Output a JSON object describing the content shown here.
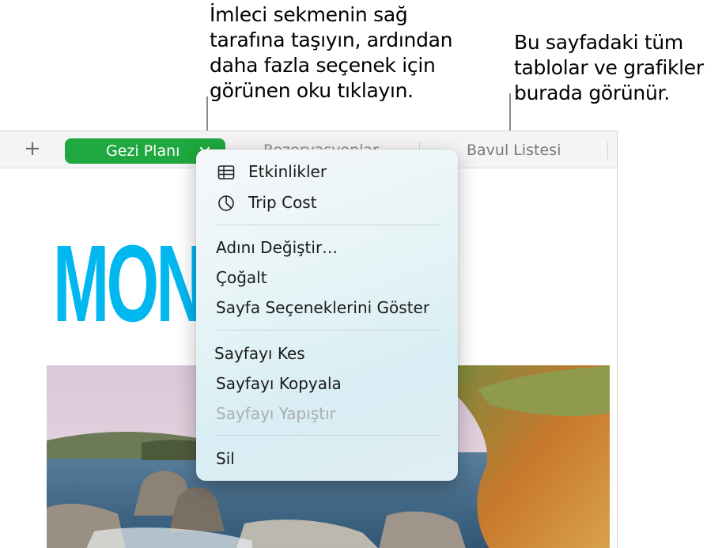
{
  "callouts": {
    "left": "İmleci sekmenin sağ\ntarafına taşıyın, ardından\ndaha fazla seçenek için\ngörünen oku tıklayın.",
    "right": "Bu sayfadaki tüm\ntablolar ve grafikler\nburada görünür."
  },
  "tabbar": {
    "add": "+",
    "tabs": [
      "Gezi Planı",
      "Rezervasyonlar",
      "Bavul Listesi"
    ],
    "active_color": "#1fa83f"
  },
  "page": {
    "title": "MON"
  },
  "menu": {
    "objects": [
      {
        "label": "Etkinlikler",
        "icon": "table-icon"
      },
      {
        "label": "Trip Cost",
        "icon": "pie-chart-icon"
      }
    ],
    "group1": [
      "Adını Değiştir…",
      "Çoğalt",
      "Sayfa Seçeneklerini Göster"
    ],
    "group2": [
      "Sayfayı Kes",
      "Sayfayı Kopyala",
      "Sayfayı Yapıştır"
    ],
    "group3": [
      "Sil"
    ]
  }
}
